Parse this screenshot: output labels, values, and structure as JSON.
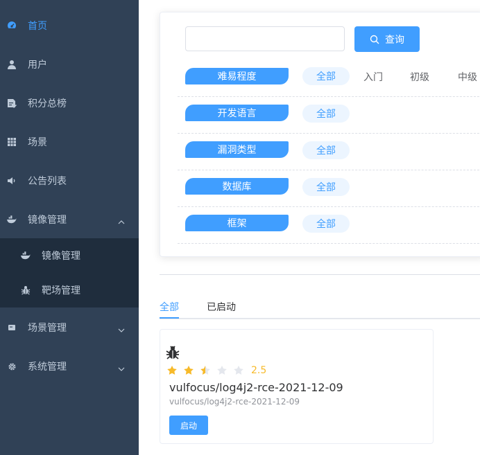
{
  "sidebar": {
    "items": [
      {
        "label": "首页",
        "icon": "dashboard-icon"
      },
      {
        "label": "用户",
        "icon": "user-icon"
      },
      {
        "label": "积分总榜",
        "icon": "document-edit-icon"
      },
      {
        "label": "场景",
        "icon": "table-grid-icon"
      },
      {
        "label": "公告列表",
        "icon": "speaker-icon"
      },
      {
        "label": "镜像管理",
        "icon": "docker-icon"
      },
      {
        "label": "场景管理",
        "icon": "form-icon"
      },
      {
        "label": "系统管理",
        "icon": "gear-icon"
      }
    ],
    "submenu": [
      {
        "label": "镜像管理",
        "icon": "docker-icon"
      },
      {
        "label": "靶场管理",
        "icon": "bug-icon"
      }
    ]
  },
  "search": {
    "placeholder": "",
    "value": "",
    "button_label": "查询"
  },
  "filters": [
    {
      "label": "难易程度",
      "all": "全部",
      "options": [
        "入门",
        "初级",
        "中级"
      ]
    },
    {
      "label": "开发语言",
      "all": "全部",
      "options": []
    },
    {
      "label": "漏洞类型",
      "all": "全部",
      "options": []
    },
    {
      "label": "数据库",
      "all": "全部",
      "options": []
    },
    {
      "label": "框架",
      "all": "全部",
      "options": []
    }
  ],
  "tabs": [
    {
      "label": "全部",
      "active": true
    },
    {
      "label": "已启动",
      "active": false
    }
  ],
  "image_card": {
    "rating": 2.5,
    "rating_text": "2.5",
    "max_rating": 5,
    "title": "vulfocus/log4j2-rce-2021-12-09",
    "subtitle": "vulfocus/log4j2-rce-2021-12-09",
    "button_label": "启动"
  },
  "colors": {
    "accent": "#409eff",
    "sidebar_bg": "#304156",
    "submenu_bg": "#1f2d3d",
    "star": "#f7ba2a"
  }
}
